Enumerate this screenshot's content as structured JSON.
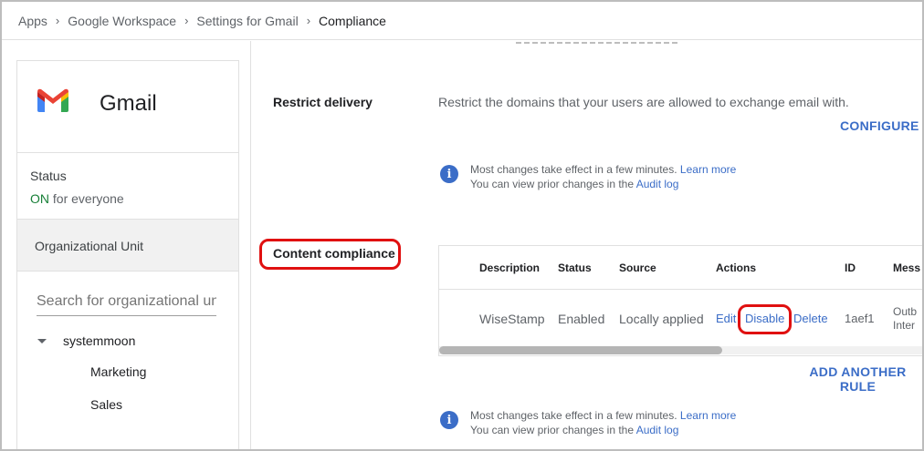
{
  "breadcrumb": {
    "items": [
      "Apps",
      "Google Workspace",
      "Settings for Gmail",
      "Compliance"
    ],
    "separator": "›"
  },
  "sidebar": {
    "app_name": "Gmail",
    "logo_colors": {
      "blue": "#4285f4",
      "red": "#ea4335",
      "yellow": "#fbbc04",
      "green": "#34a853"
    },
    "status_title": "Status",
    "status_on": "ON",
    "status_rest": "for everyone",
    "ou_header": "Organizational Unit",
    "search_placeholder": "Search for organizational units",
    "tree": {
      "root": "systemmoon",
      "children": [
        "Marketing",
        "Sales"
      ]
    }
  },
  "restrict_delivery": {
    "label": "Restrict delivery",
    "description": "Restrict the domains that your users are allowed to exchange email with.",
    "configure": "CONFIGURE",
    "info_line1": "Most changes take effect in a few minutes.",
    "info_link1": "Learn more",
    "info_line2": "You can view prior changes in the",
    "info_link2": "Audit log"
  },
  "content_compliance": {
    "label": "Content compliance",
    "table": {
      "headers": [
        "Description",
        "Status",
        "Source",
        "Actions",
        "ID",
        "Mess"
      ],
      "row": {
        "description": "WiseStamp",
        "status": "Enabled",
        "source": "Locally applied",
        "edit": "Edit",
        "disable": "Disable",
        "delete": "Delete",
        "id": "1aef1",
        "message_line1": "Outb",
        "message_line2": "Inter"
      },
      "scroll_fraction": 0.58
    },
    "add_rule": "ADD ANOTHER RULE",
    "info_line1": "Most changes take effect in a few minutes.",
    "info_link1": "Learn more",
    "info_line2": "You can view prior changes in the",
    "info_link2": "Audit log"
  },
  "colors": {
    "accent": "#3b6dc7",
    "highlight": "#e01010",
    "status_on": "#188038"
  }
}
